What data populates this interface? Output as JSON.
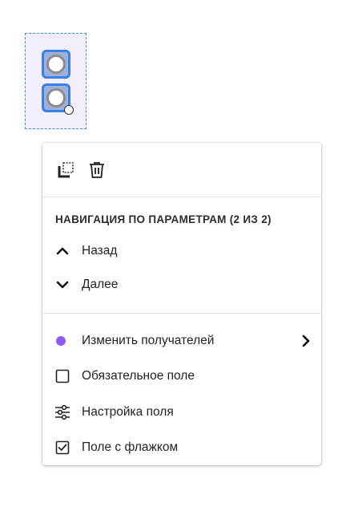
{
  "menu": {
    "toolbar": {
      "icons": [
        "copy-icon",
        "trash-icon"
      ]
    },
    "section_heading": "НАВИГАЦИЯ ПО ПАРАМЕТРАМ (2 ИЗ 2)",
    "nav_items": [
      {
        "label": "Назад",
        "icon": "chevron-up-icon"
      },
      {
        "label": "Далее",
        "icon": "chevron-down-icon"
      }
    ],
    "action_items": [
      {
        "label": "Изменить получателей",
        "icon": "recipient-dot-icon",
        "color": "#8b5cf6",
        "has_submenu": true
      },
      {
        "label": "Обязательное поле",
        "icon": "checkbox-unchecked-icon"
      },
      {
        "label": "Настройка поля",
        "icon": "sliders-icon"
      },
      {
        "label": "Поле с флажком",
        "icon": "checkbox-checked-icon"
      }
    ]
  },
  "colors": {
    "selection_border": "#3b8fd9",
    "selection_fill": "#f2effb",
    "field_border": "#3a80e6",
    "recipient_dot": "#8b5cf6"
  }
}
